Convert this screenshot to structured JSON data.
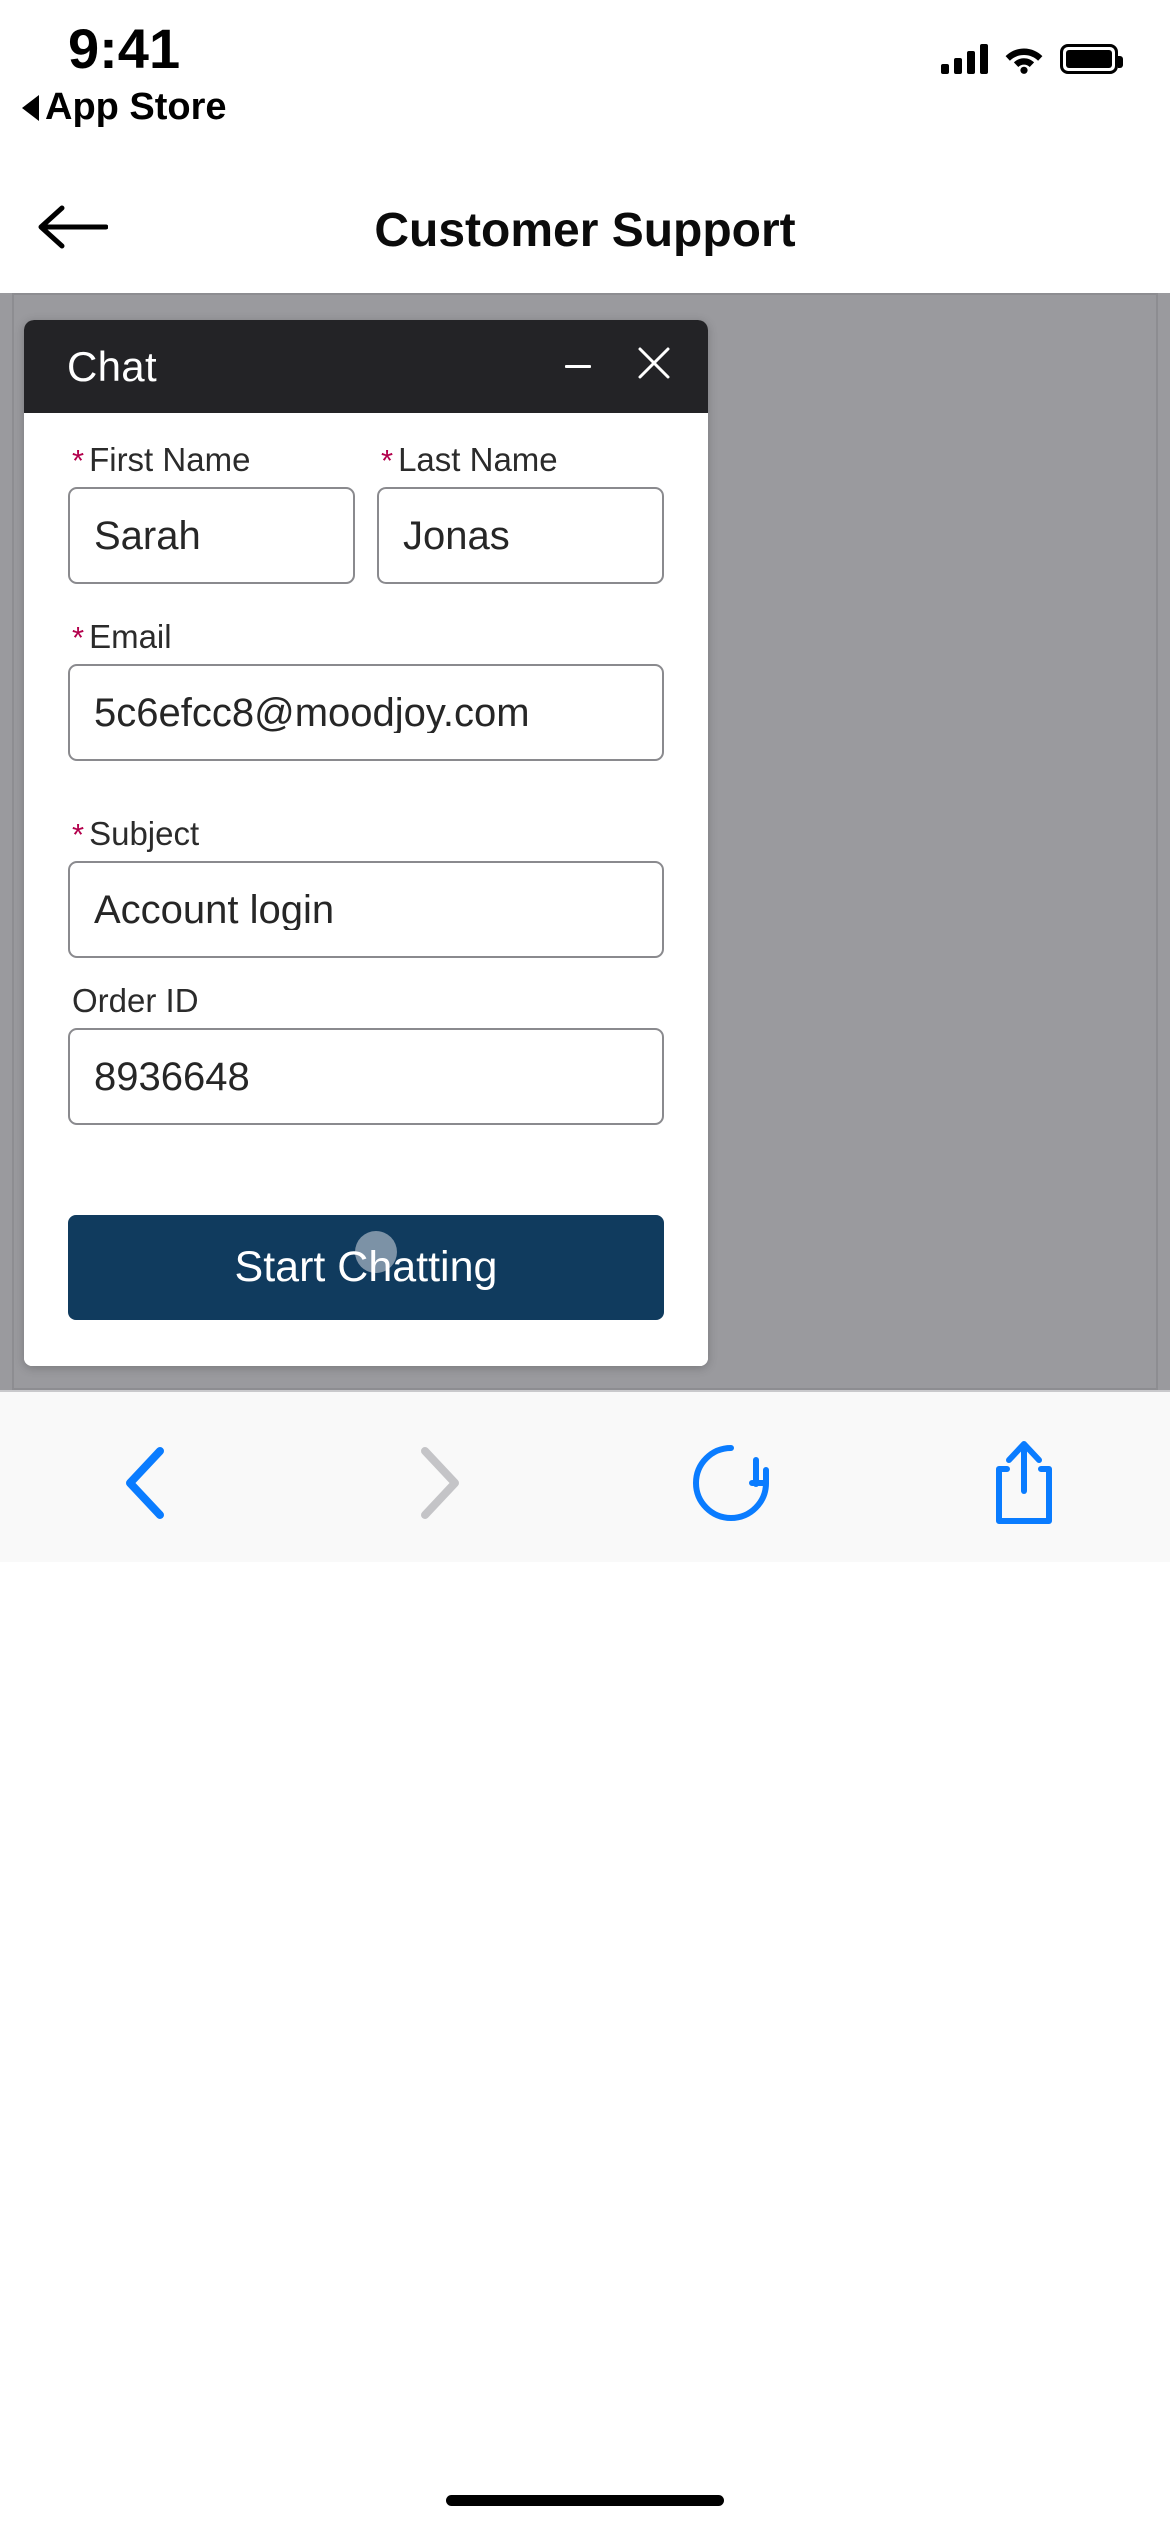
{
  "status_bar": {
    "time": "9:41",
    "return_label": "App Store",
    "return_arrow_icon": "triangle-left-icon",
    "cellular_icon": "cellular-bars-icon",
    "wifi_icon": "wifi-icon",
    "battery_icon": "battery-full-icon"
  },
  "nav_bar": {
    "back_icon": "arrow-left-icon",
    "title": "Customer Support"
  },
  "chat_widget": {
    "header": {
      "title": "Chat",
      "minimize_icon": "minimize-icon",
      "minimize_label": "—",
      "close_icon": "close-icon",
      "close_label": "×"
    },
    "required_marker": "*",
    "fields": [
      {
        "name": "first-name",
        "label": "First Name",
        "required": true,
        "value": "Sarah",
        "placeholder": "First Name"
      },
      {
        "name": "last-name",
        "label": "Last Name",
        "required": true,
        "value": "Jonas",
        "placeholder": "Last Name"
      },
      {
        "name": "email",
        "label": "Email",
        "required": true,
        "value": "5c6efcc8@moodjoy.com",
        "placeholder": "Email"
      },
      {
        "name": "subject",
        "label": "Subject",
        "required": true,
        "value": "Account login",
        "placeholder": "Subject"
      },
      {
        "name": "order-id",
        "label": "Order ID",
        "required": false,
        "value": "8936648",
        "placeholder": "Order ID"
      }
    ],
    "submit_button": {
      "label": "Start Chatting"
    }
  },
  "browser_toolbar": {
    "items": [
      {
        "name": "back",
        "icon": "chevron-left-icon",
        "enabled": true
      },
      {
        "name": "forward",
        "icon": "chevron-right-icon",
        "enabled": false
      },
      {
        "name": "reload",
        "icon": "reload-icon",
        "enabled": true
      },
      {
        "name": "share",
        "icon": "share-icon",
        "enabled": true
      }
    ]
  },
  "colors": {
    "accent_blue": "#0a7cff",
    "cta_navy": "#103b5e",
    "required_red": "#b3004c",
    "widget_header": "#232326",
    "page_backdrop": "#9a9a9e",
    "disabled_gray": "#c4c4c7"
  }
}
